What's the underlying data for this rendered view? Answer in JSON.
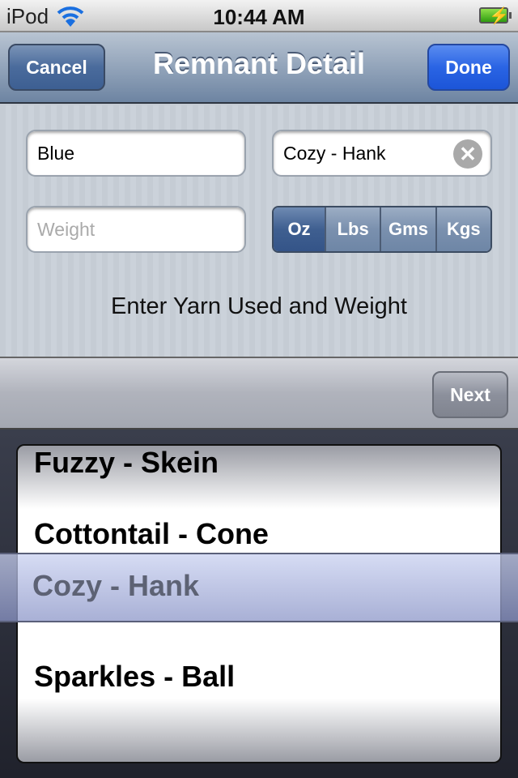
{
  "status": {
    "carrier": "iPod",
    "time": "10:44 AM",
    "battery_icon": "battery-charging-icon",
    "wifi_icon": "wifi-icon"
  },
  "nav": {
    "title": "Remnant Detail",
    "cancel": "Cancel",
    "done": "Done"
  },
  "form": {
    "color_value": "Blue",
    "yarn_value": "Cozy - Hank",
    "weight_placeholder": "Weight",
    "units": [
      "Oz",
      "Lbs",
      "Gms",
      "Kgs"
    ],
    "selected_unit": "Oz",
    "hint": "Enter Yarn Used and Weight"
  },
  "toolbar": {
    "next": "Next"
  },
  "picker": {
    "items": [
      "Fuzzy - Skein",
      "Cottontail - Cone",
      "Cozy - Hank",
      "Sparkles - Ball"
    ],
    "selected": "Cozy - Hank"
  }
}
